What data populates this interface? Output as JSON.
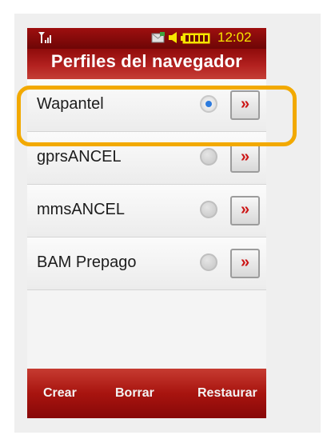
{
  "status_bar": {
    "signal_icon": "signal-strength-icon",
    "message_icon": "message-icon",
    "volume_icon": "speaker-icon",
    "battery_icon": "battery-icon",
    "time": "12:02",
    "time_color": "#f7e600"
  },
  "header": {
    "title": "Perfiles del navegador"
  },
  "profiles": [
    {
      "label": "Wapantel",
      "selected": true,
      "detail_glyph": "»"
    },
    {
      "label": "gprsANCEL",
      "selected": false,
      "detail_glyph": "»"
    },
    {
      "label": "mmsANCEL",
      "selected": false,
      "detail_glyph": "»"
    },
    {
      "label": "BAM Prepago",
      "selected": false,
      "detail_glyph": "»"
    }
  ],
  "softkeys": {
    "create": "Crear",
    "delete": "Borrar",
    "restore": "Restaurar"
  },
  "colors": {
    "header_red": "#a8140f",
    "highlight_orange": "#f2a900",
    "radio_selected_blue": "#2c7bde",
    "arrow_red": "#cc1515"
  }
}
